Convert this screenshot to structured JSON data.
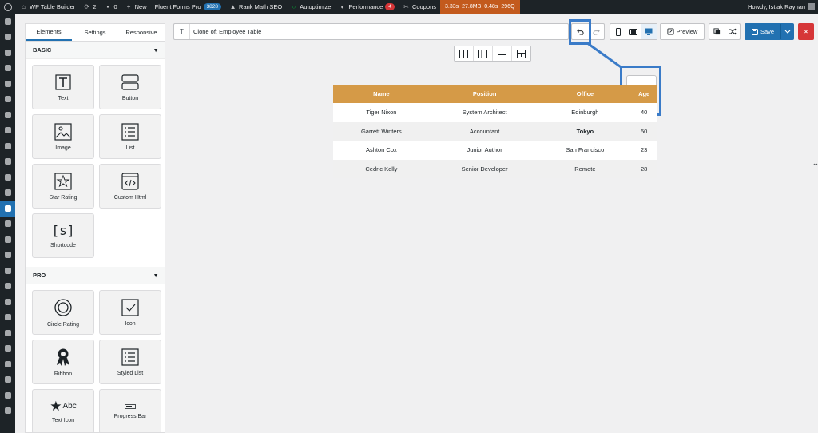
{
  "adminbar": {
    "site_name": "WP Table Builder",
    "updates_count": "2",
    "comments_count": "0",
    "new_label": "New",
    "fluent_forms_label": "Fluent Forms Pro",
    "fluent_forms_badge": "3828",
    "rank_math_label": "Rank Math SEO",
    "autoptimize_label": "Autoptimize",
    "performance_label": "Performance",
    "performance_badge": "4",
    "coupons_label": "Coupons",
    "perf_time": "3.33s",
    "perf_mem": "27.8MB",
    "perf_query_time": "0.48s",
    "perf_queries": "296Q",
    "howdy": "Howdy, Istiak Rayhan"
  },
  "panel": {
    "tabs": [
      {
        "label": "Elements",
        "active": true
      },
      {
        "label": "Settings",
        "active": false
      },
      {
        "label": "Responsive",
        "active": false
      }
    ],
    "basic": {
      "title": "BASIC",
      "toggle": "▾",
      "items": [
        {
          "label": "Text",
          "icon": "text-icon"
        },
        {
          "label": "Button",
          "icon": "button-icon"
        },
        {
          "label": "Image",
          "icon": "image-icon"
        },
        {
          "label": "List",
          "icon": "list-icon"
        },
        {
          "label": "Star Rating",
          "icon": "star-icon"
        },
        {
          "label": "Custom Html",
          "icon": "code-icon"
        },
        {
          "label": "Shortcode",
          "icon": "shortcode-icon",
          "glyph": "[s]"
        }
      ]
    },
    "pro": {
      "title": "PRO",
      "toggle": "▾",
      "items": [
        {
          "label": "Circle Rating",
          "icon": "circle-rating-icon"
        },
        {
          "label": "Icon",
          "icon": "checkbox-icon"
        },
        {
          "label": "Ribbon",
          "icon": "ribbon-icon"
        },
        {
          "label": "Styled List",
          "icon": "styled-list-icon"
        },
        {
          "label": "Text Icon",
          "icon": "star-text-icon",
          "glyph": "Abc"
        },
        {
          "label": "Progress Bar",
          "icon": "progress-bar-icon"
        }
      ]
    }
  },
  "toolbar": {
    "title_value": "Clone of: Employee Table",
    "title_prefix_glyph": "T",
    "preview_label": "Preview",
    "save_label": "Save"
  },
  "table": {
    "headers": [
      "Name",
      "Position",
      "Office",
      "Age"
    ],
    "rows": [
      [
        "Tiger Nixon",
        "System Architect",
        "Edinburgh",
        "40"
      ],
      [
        "Garrett Winters",
        "Accountant",
        "Tokyo",
        "50"
      ],
      [
        "Ashton Cox",
        "Junior Author",
        "San Francisco",
        "23"
      ],
      [
        "Cedric Kelly",
        "Senior Developer",
        "Remote",
        "28"
      ]
    ],
    "header_color": "#d59a47"
  },
  "colors": {
    "accent": "#2271b1",
    "danger": "#d63638",
    "highlight": "#3a7bc8"
  }
}
